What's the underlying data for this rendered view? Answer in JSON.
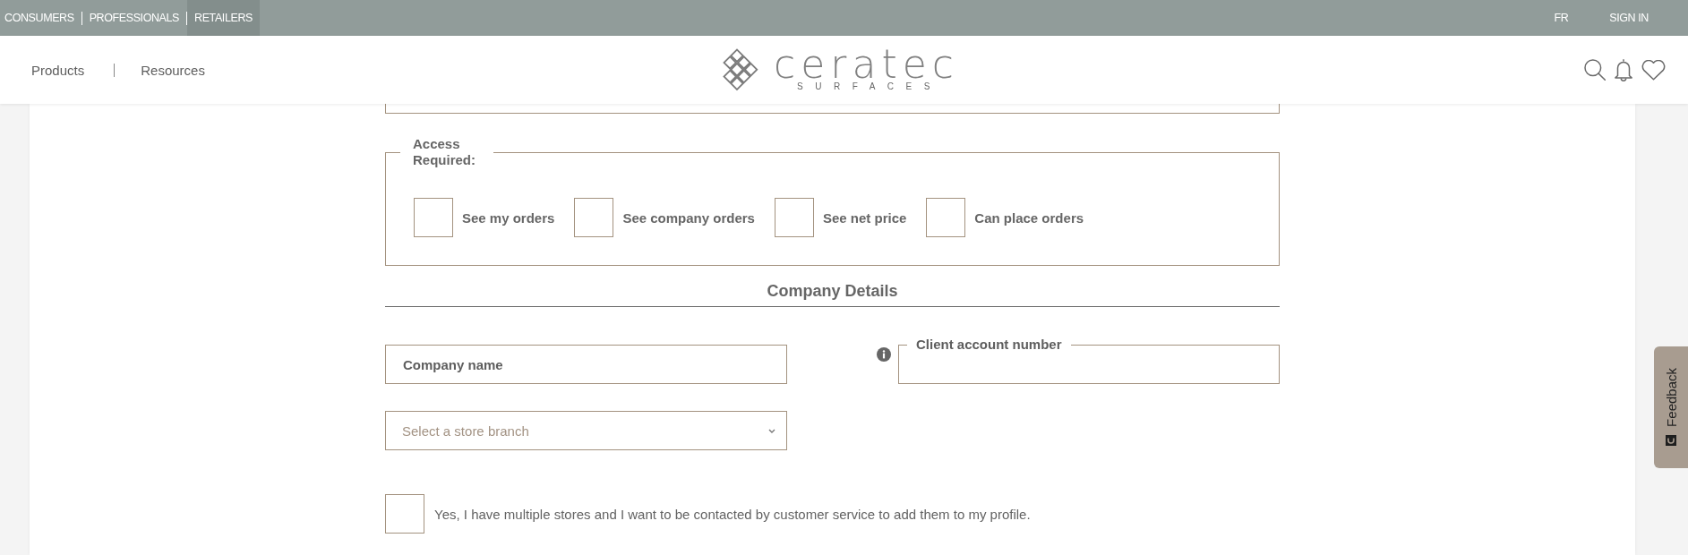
{
  "top_bar": {
    "audiences": [
      {
        "label": "CONSUMERS",
        "selected": false
      },
      {
        "label": "PROFESSIONALS",
        "selected": false
      },
      {
        "label": "RETAILERS",
        "selected": true
      }
    ],
    "language": "FR",
    "sign_in": "SIGN IN"
  },
  "header": {
    "nav": [
      {
        "label": "Products"
      },
      {
        "label": "Resources"
      }
    ],
    "logo": {
      "wordmark": "ceratec",
      "tagline": "SURFACES"
    }
  },
  "access_required": {
    "legend": "Access Required:",
    "options": [
      {
        "label": "See my orders",
        "checked": false
      },
      {
        "label": "See company orders",
        "checked": false
      },
      {
        "label": "See net price",
        "checked": false
      },
      {
        "label": "Can place orders",
        "checked": false
      }
    ]
  },
  "company_details": {
    "title": "Company Details",
    "company_name": {
      "label": "Company name"
    },
    "client_account": {
      "label": "Client account number"
    },
    "store_branch": {
      "placeholder": "Select a store branch"
    },
    "multiple_stores": {
      "label": "Yes, I have multiple stores and I want to be contacted by customer service to add them to my profile.",
      "checked": false
    }
  },
  "feedback_tab": {
    "label": "Feedback"
  }
}
